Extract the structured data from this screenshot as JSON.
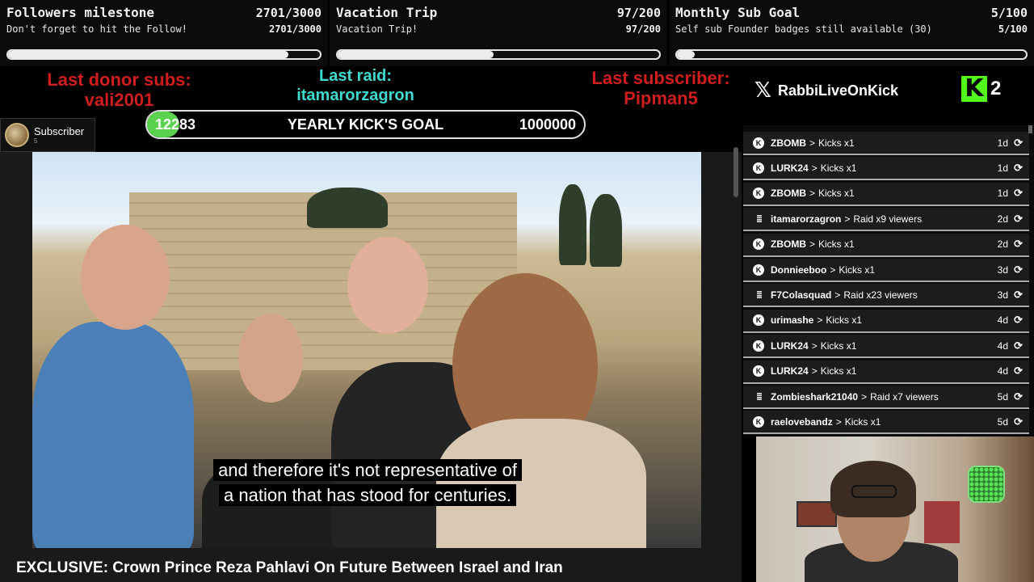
{
  "goals": [
    {
      "title": "Followers milestone",
      "count": "2701/3000",
      "subtitle": "Don't forget to hit the Follow!",
      "subcount": "2701/3000",
      "progress": 0.9
    },
    {
      "title": "Vacation Trip",
      "count": "97/200",
      "subtitle": "Vacation Trip!",
      "subcount": "97/200",
      "progress": 0.485
    },
    {
      "title": "Monthly Sub Goal",
      "count": "5/100",
      "subtitle": "Self sub Founder badges still available (30)",
      "subcount": "5/100",
      "progress": 0.05
    }
  ],
  "last": {
    "donor_label": "Last donor subs:",
    "donor_name": "vali2001",
    "raid_label": "Last raid:",
    "raid_name": "itamarorzagron",
    "subscriber_label": "Last subscriber:",
    "subscriber_name": "Pipman5"
  },
  "kick_goal": {
    "current": "12283",
    "label": "YEARLY KICK'S GOAL",
    "target": "1000000",
    "progress": 0.01228
  },
  "subscriber_chip": {
    "label": "Subscriber",
    "count": "5"
  },
  "social": {
    "handle": "RabbiLiveOnKick",
    "kick_count": "2",
    "x_icon": "x-logo-icon",
    "kick_icon": "kick-logo-icon"
  },
  "video": {
    "subtitle_line1": "and therefore it's not representative of",
    "subtitle_line2": "a nation that has stood for centuries.",
    "title": "EXCLUSIVE: Crown Prince Reza Pahlavi On Future Between Israel and Iran"
  },
  "feed": [
    {
      "type": "kick",
      "name": "ZBOMB",
      "action": "Kicks x1",
      "age": "1d"
    },
    {
      "type": "kick",
      "name": "LURK24",
      "action": "Kicks x1",
      "age": "1d"
    },
    {
      "type": "kick",
      "name": "ZBOMB",
      "action": "Kicks x1",
      "age": "1d"
    },
    {
      "type": "raid",
      "name": "itamarorzagron",
      "action": "Raid x9 viewers",
      "age": "2d"
    },
    {
      "type": "kick",
      "name": "ZBOMB",
      "action": "Kicks x1",
      "age": "2d"
    },
    {
      "type": "kick",
      "name": "Donnieeboo",
      "action": "Kicks x1",
      "age": "3d"
    },
    {
      "type": "raid",
      "name": "F7Colasquad",
      "action": "Raid x23 viewers",
      "age": "3d"
    },
    {
      "type": "kick",
      "name": "urimashe",
      "action": "Kicks x1",
      "age": "4d"
    },
    {
      "type": "kick",
      "name": "LURK24",
      "action": "Kicks x1",
      "age": "4d"
    },
    {
      "type": "kick",
      "name": "LURK24",
      "action": "Kicks x1",
      "age": "4d"
    },
    {
      "type": "raid",
      "name": "Zombieshark21040",
      "action": "Raid x7 viewers",
      "age": "5d"
    },
    {
      "type": "kick",
      "name": "raelovebandz",
      "action": "Kicks x1",
      "age": "5d"
    }
  ],
  "colors": {
    "kick_green": "#53fc18",
    "alert_red": "#d01d1d",
    "raid_cyan": "#3fd9d0"
  }
}
